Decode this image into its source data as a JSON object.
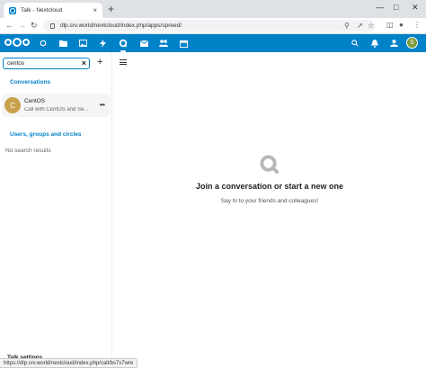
{
  "browser": {
    "tab_title": "Talk - Nextcloud",
    "tab_close": "×",
    "new_tab": "+",
    "url": "dlp.srv.world/nextcloud/index.php/apps/spreed/",
    "status_url": "https://dlp.srv.world/nextcloud/index.php/call/bs7v7wre"
  },
  "left_panel": {
    "search_value": "centos",
    "search_clear": "×",
    "new_button": "+",
    "conversations_title": "Conversations",
    "conversation": {
      "avatar_letter": "C",
      "name": "CentOS",
      "subtitle": "Call with CentOS and Se...",
      "menu": "•••"
    },
    "users_title": "Users, groups and circles",
    "no_results": "No search results",
    "bottom_label": "Talk settings"
  },
  "main": {
    "empty_title": "Join a conversation or start a new one",
    "empty_subtitle": "Say hi to your friends and colleagues!"
  },
  "header": {
    "avatar_letter": "S",
    "brand_color": "#0082c9"
  }
}
